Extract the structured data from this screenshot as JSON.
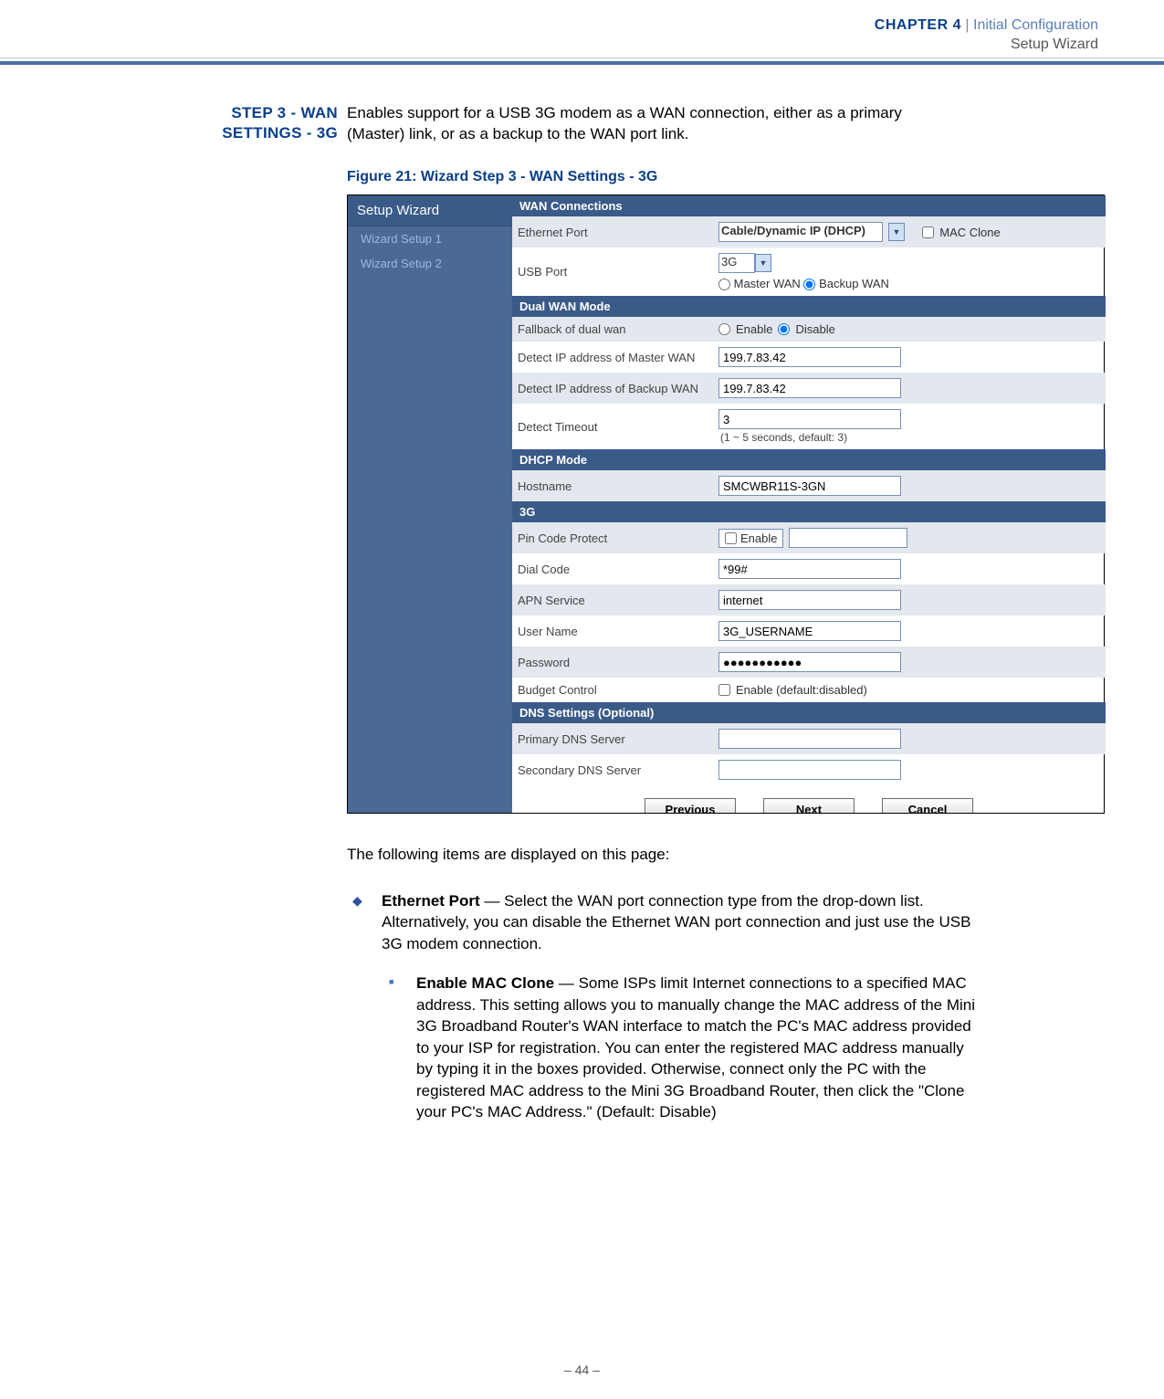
{
  "header": {
    "chapter": "CHAPTER 4",
    "pipe": "|",
    "title": "Initial Configuration",
    "subtitle": "Setup Wizard"
  },
  "step_heading": {
    "line1": "STEP 3 - WAN",
    "line2": "SETTINGS - 3G"
  },
  "intro": "Enables support for a USB 3G modem as a WAN connection, either as a primary (Master) link, or as a backup to the WAN port link.",
  "figure_caption": "Figure 21:  Wizard Step 3 - WAN Settings - 3G",
  "wizard": {
    "sidebar": {
      "title": "Setup Wizard",
      "items": [
        "Wizard Setup 1",
        "Wizard Setup 2"
      ]
    },
    "sections": {
      "wan_connections": {
        "header": "WAN Connections",
        "ethernet_port_label": "Ethernet Port",
        "ethernet_port_value": "Cable/Dynamic IP (DHCP)",
        "mac_clone_label": "MAC Clone",
        "usb_port_label": "USB Port",
        "usb_port_value": "3G",
        "master_wan_label": "Master WAN",
        "backup_wan_label": "Backup WAN"
      },
      "dual_wan": {
        "header": "Dual WAN Mode",
        "fallback_label": "Fallback of dual wan",
        "enable_label": "Enable",
        "disable_label": "Disable",
        "detect_master_label": "Detect IP address of Master WAN",
        "detect_master_value": "199.7.83.42",
        "detect_backup_label": "Detect IP address of Backup WAN",
        "detect_backup_value": "199.7.83.42",
        "detect_timeout_label": "Detect Timeout",
        "detect_timeout_value": "3",
        "detect_timeout_hint": "(1 ~ 5 seconds, default: 3)"
      },
      "dhcp": {
        "header": "DHCP Mode",
        "hostname_label": "Hostname",
        "hostname_value": "SMCWBR11S-3GN"
      },
      "g3": {
        "header": "3G",
        "pin_label": "Pin Code Protect",
        "pin_enable_label": "Enable",
        "pin_value": "",
        "dial_label": "Dial Code",
        "dial_value": "*99#",
        "apn_label": "APN Service",
        "apn_value": "internet",
        "user_label": "User Name",
        "user_value": "3G_USERNAME",
        "pass_label": "Password",
        "pass_value": "●●●●●●●●●●●",
        "budget_label": "Budget Control",
        "budget_hint": "Enable (default:disabled)"
      },
      "dns": {
        "header": "DNS Settings (Optional)",
        "primary_label": "Primary DNS Server",
        "primary_value": "",
        "secondary_label": "Secondary DNS Server",
        "secondary_value": ""
      }
    },
    "buttons": {
      "previous": "Previous",
      "next": "Next",
      "cancel": "Cancel"
    }
  },
  "post_para": "The following items are displayed on this page:",
  "bullets": {
    "ethernet": {
      "title": "Ethernet Port",
      "text": " — Select the WAN port connection type from the drop-down list. Alternatively, you can disable the Ethernet WAN port connection and just use the USB 3G modem connection."
    },
    "mac_clone": {
      "title": "Enable MAC Clone",
      "text": " — Some ISPs limit Internet connections to a specified MAC address. This setting allows you to manually change the MAC address of the Mini 3G Broadband Router's WAN interface to match the PC's MAC address provided to your ISP for registration. You can enter the registered MAC address manually by typing it in the boxes provided. Otherwise, connect only the PC with the registered MAC address to the Mini 3G Broadband Router, then click the \"Clone your PC's MAC Address.\" (Default: Disable)"
    }
  },
  "footer": {
    "page": "–  44  –"
  }
}
